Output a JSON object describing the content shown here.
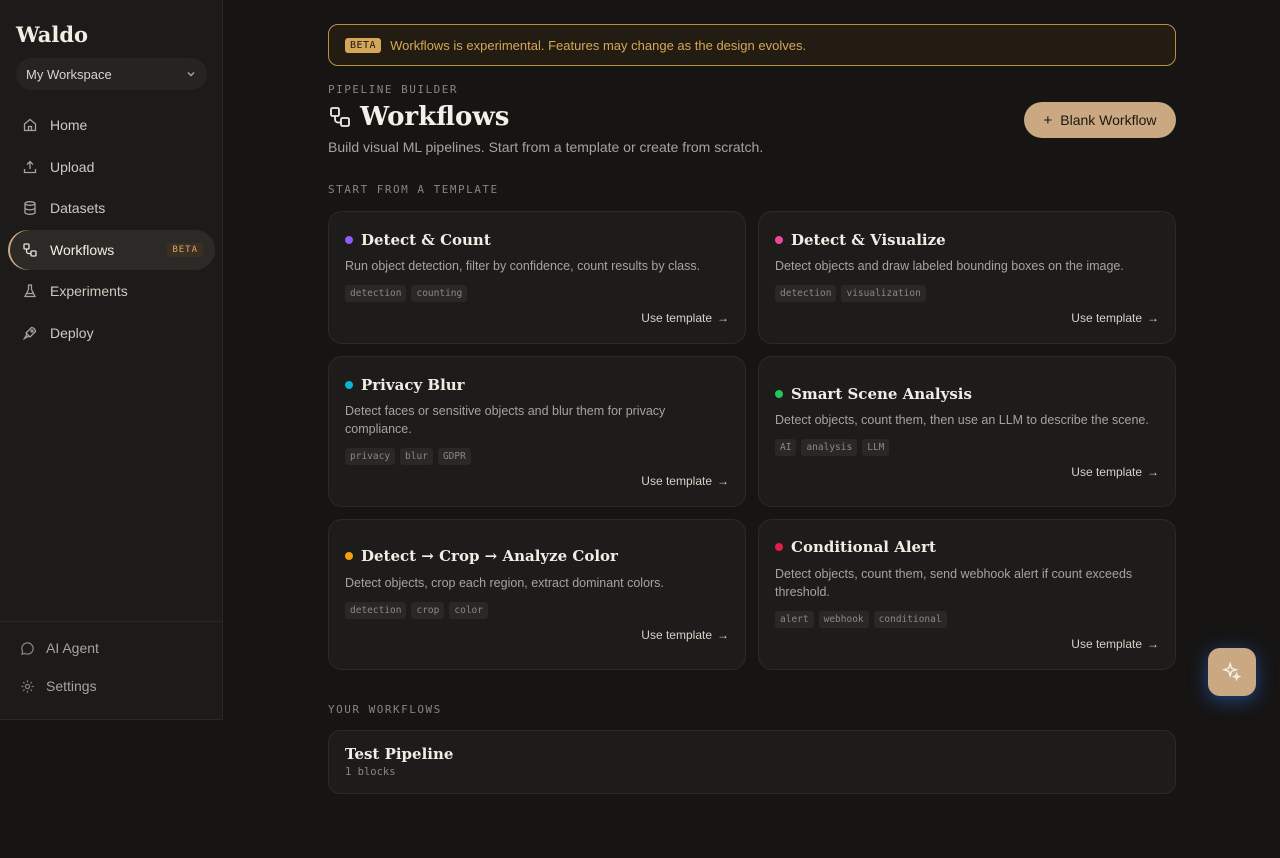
{
  "app": {
    "brand": "Waldo",
    "workspace": "My Workspace"
  },
  "sidebar": {
    "items": [
      {
        "label": "Home",
        "icon": "home-icon"
      },
      {
        "label": "Upload",
        "icon": "upload-icon"
      },
      {
        "label": "Datasets",
        "icon": "database-icon"
      },
      {
        "label": "Workflows",
        "icon": "workflow-icon",
        "badge": "BETA",
        "active": true
      },
      {
        "label": "Experiments",
        "icon": "flask-icon"
      },
      {
        "label": "Deploy",
        "icon": "rocket-icon"
      }
    ],
    "bottom": [
      {
        "label": "AI Agent",
        "icon": "chat-icon"
      },
      {
        "label": "Settings",
        "icon": "gear-icon"
      }
    ]
  },
  "banner": {
    "tag": "BETA",
    "text": "Workflows is experimental. Features may change as the design evolves."
  },
  "header": {
    "kicker": "PIPELINE BUILDER",
    "title": "Workflows",
    "subtitle": "Build visual ML pipelines. Start from a template or create from scratch.",
    "blank_button": "Blank Workflow"
  },
  "templates_section": {
    "label": "START FROM A TEMPLATE",
    "use_label": "Use template"
  },
  "templates": [
    {
      "name": "Detect & Count",
      "color": "#8b5cf6",
      "desc": "Run object detection, filter by confidence, count results by class.",
      "tags": [
        "detection",
        "counting"
      ]
    },
    {
      "name": "Detect & Visualize",
      "color": "#ec4899",
      "desc": "Detect objects and draw labeled bounding boxes on the image.",
      "tags": [
        "detection",
        "visualization"
      ]
    },
    {
      "name": "Privacy Blur",
      "color": "#06b6d4",
      "desc": "Detect faces or sensitive objects and blur them for privacy compliance.",
      "tags": [
        "privacy",
        "blur",
        "GDPR"
      ]
    },
    {
      "name": "Smart Scene Analysis",
      "color": "#22c55e",
      "desc": "Detect objects, count them, then use an LLM to describe the scene.",
      "tags": [
        "AI",
        "analysis",
        "LLM"
      ]
    },
    {
      "name": "Detect → Crop → Analyze Color",
      "color": "#f59e0b",
      "desc": "Detect objects, crop each region, extract dominant colors.",
      "tags": [
        "detection",
        "crop",
        "color"
      ]
    },
    {
      "name": "Conditional Alert",
      "color": "#e11d48",
      "desc": "Detect objects, count them, send webhook alert if count exceeds threshold.",
      "tags": [
        "alert",
        "webhook",
        "conditional"
      ]
    }
  ],
  "your_workflows": {
    "label": "YOUR WORKFLOWS",
    "items": [
      {
        "name": "Test Pipeline",
        "meta": "1 blocks"
      }
    ]
  },
  "fab": {
    "icon": "sparkle-icon"
  }
}
